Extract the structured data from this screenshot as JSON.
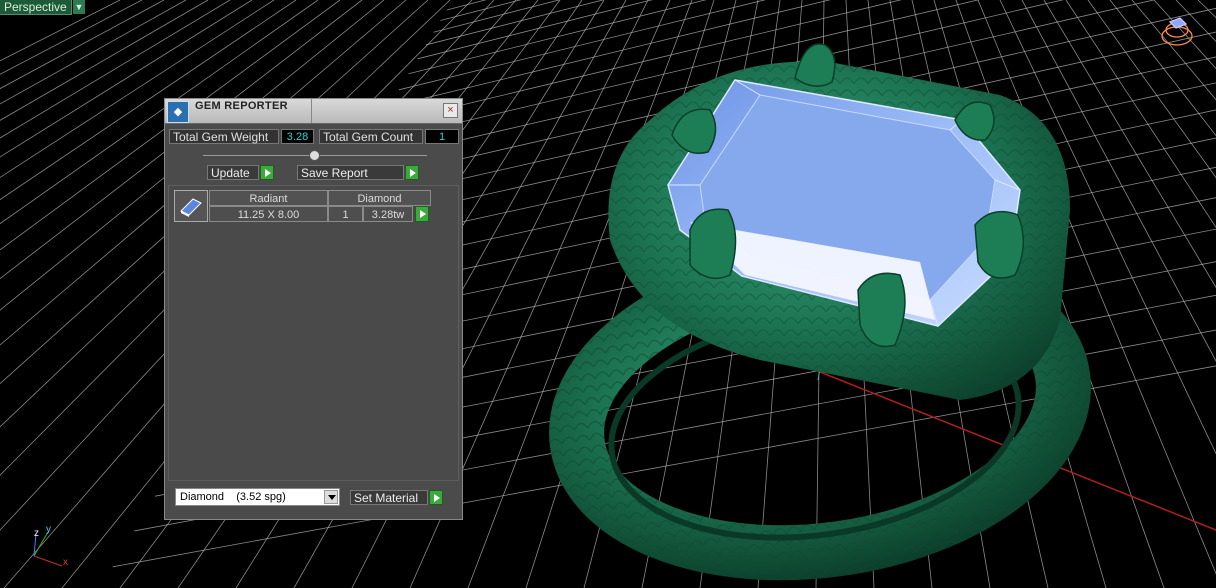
{
  "viewport": {
    "view_label": "Perspective",
    "axis": {
      "z": "z",
      "y": "y",
      "x": "x"
    }
  },
  "panel": {
    "title": "GEM REPORTER",
    "close_label": "×",
    "total_gem_weight_label": "Total Gem Weight",
    "total_gem_weight_value": "3.28",
    "total_gem_count_label": "Total Gem Count",
    "total_gem_count_value": "1",
    "update_label": "Update",
    "save_report_label": "Save Report",
    "gem_table": {
      "shape": "Radiant",
      "material": "Diamond",
      "size": "11.25 X 8.00",
      "count": "1",
      "weight": "3.28tw"
    },
    "material_select": {
      "selected": "Diamond    (3.52 spg)"
    },
    "set_material_label": "Set Material"
  },
  "colors": {
    "ring_green": "#1f7a55",
    "gem_blue": "#8fb4f4",
    "grid": "#b8b8b8",
    "accent_green": "#3da83d"
  }
}
